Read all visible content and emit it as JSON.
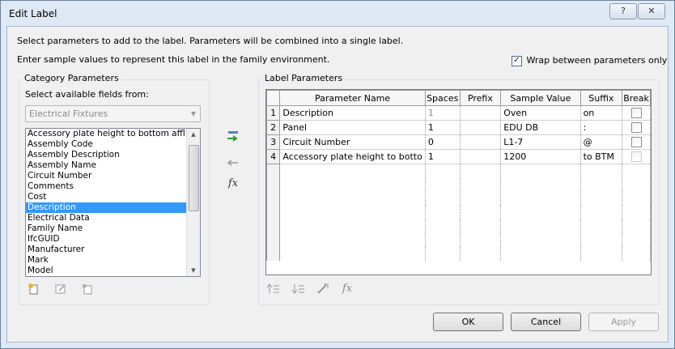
{
  "window": {
    "title": "Edit Label",
    "help_label": "?",
    "close_label": "✕"
  },
  "instructions": {
    "line1": "Select parameters to add to the label.  Parameters will be combined into a single label.",
    "line2": "Enter sample values to represent this label in the family environment."
  },
  "wrap_option": {
    "label": "Wrap between parameters only",
    "checked": true
  },
  "category_parameters": {
    "group_label": "Category Parameters",
    "fields_label": "Select available fields from:",
    "source_value": "Electrical Fixtures",
    "items": [
      "Accessory plate height to bottom affl",
      "Assembly Code",
      "Assembly Description",
      "Assembly Name",
      "Circuit Number",
      "Comments",
      "Cost",
      "Description",
      "Electrical Data",
      "Family Name",
      "IfcGUID",
      "Manufacturer",
      "Mark",
      "Model"
    ],
    "selected_item": "Description"
  },
  "label_parameters": {
    "group_label": "Label Parameters",
    "columns": [
      "Parameter Name",
      "Spaces",
      "Prefix",
      "Sample Value",
      "Suffix",
      "Break"
    ],
    "rows": [
      {
        "num": "1",
        "name": "Description",
        "spaces": "1",
        "prefix": "",
        "sample": "Oven",
        "suffix": "on",
        "break": false
      },
      {
        "num": "2",
        "name": "Panel",
        "spaces": "1",
        "prefix": "",
        "sample": "EDU DB",
        "suffix": ":",
        "break": false
      },
      {
        "num": "3",
        "name": "Circuit Number",
        "spaces": "0",
        "prefix": "",
        "sample": "L1-7",
        "suffix": "@",
        "break": false
      },
      {
        "num": "4",
        "name": "Accessory plate height to botto",
        "spaces": "1",
        "prefix": "",
        "sample": "1200",
        "suffix": "to BTM",
        "break": false
      }
    ]
  },
  "middle_tools": {
    "add_icon": "add-parameter-icon",
    "remove_icon": "remove-parameter-icon",
    "fx_label": "fx"
  },
  "list_tools": [
    "new-parameter-icon",
    "edit-parameter-icon",
    "delete-parameter-icon"
  ],
  "grid_tools": {
    "fx_label": "fx"
  },
  "buttons": {
    "ok": "OK",
    "cancel": "Cancel",
    "apply": "Apply"
  }
}
